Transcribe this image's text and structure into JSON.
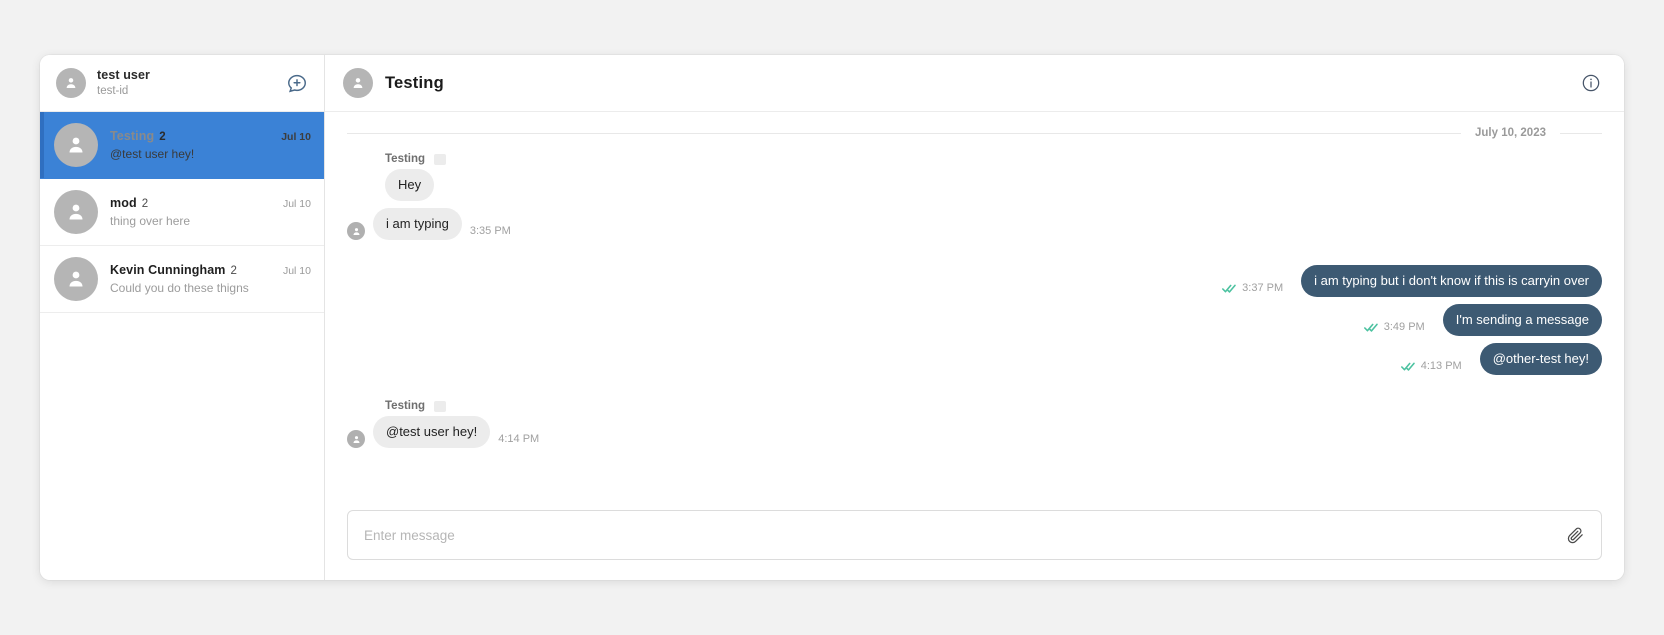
{
  "sidebar": {
    "user": {
      "name": "test user",
      "id": "test-id"
    },
    "new_chat_icon": "new-chat-bubble-plus-icon",
    "conversations": [
      {
        "name": "Testing",
        "count": "2",
        "date": "Jul 10",
        "preview": "@test user hey!",
        "active": true
      },
      {
        "name": "mod",
        "count": "2",
        "date": "Jul 10",
        "preview": "thing over here",
        "active": false
      },
      {
        "name": "Kevin Cunningham",
        "count": "2",
        "date": "Jul 10",
        "preview": "Could you do these thigns",
        "active": false
      }
    ]
  },
  "chat": {
    "title": "Testing",
    "info_icon": "info-circle-icon",
    "date_divider": "July 10, 2023",
    "sender_label": "Testing",
    "messages": [
      {
        "direction": "in",
        "text": "Hey",
        "time": "",
        "sender": "Testing"
      },
      {
        "direction": "in",
        "text": "i am typing",
        "time": "3:35 PM"
      },
      {
        "direction": "out",
        "text": "i am typing but i don't know if this is carryin over",
        "time": "3:37 PM",
        "status": "read"
      },
      {
        "direction": "out",
        "text": "I'm sending a message",
        "time": "3:49 PM",
        "status": "read"
      },
      {
        "direction": "out",
        "text": "@other-test hey!",
        "time": "4:13 PM",
        "status": "read"
      },
      {
        "direction": "in",
        "text": "@test user hey!",
        "time": "4:14 PM",
        "sender": "Testing"
      }
    ]
  },
  "composer": {
    "placeholder": "Enter message",
    "value": "",
    "attach_icon": "paperclip-icon"
  },
  "colors": {
    "accent_blue": "#3b82d6",
    "outgoing_bubble": "#3d5a73",
    "incoming_bubble": "#ececec",
    "read_tick_green": "#4cc2a0",
    "icon_slate": "#475569"
  }
}
